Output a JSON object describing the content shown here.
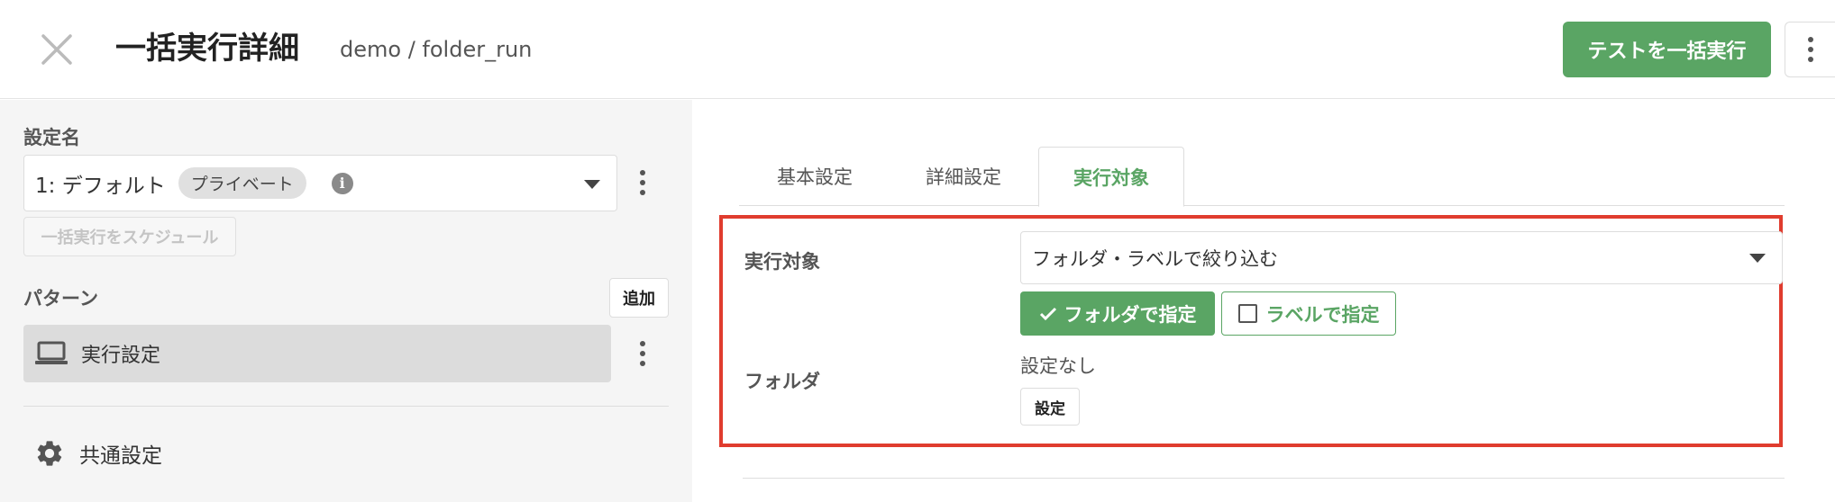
{
  "header": {
    "title": "一括実行詳細",
    "breadcrumb": "demo / folder_run",
    "run_button": "テストを一括実行",
    "close_icon": "close-icon",
    "more_icon": "more-vertical-icon"
  },
  "sidebar": {
    "config_label": "設定名",
    "config_value": "1: デフォルト",
    "private_badge": "プライベート",
    "info_icon_text": "i",
    "schedule_button": "一括実行をスケジュール",
    "pattern_label": "パターン",
    "add_button": "追加",
    "pattern_items": [
      {
        "label": "実行設定",
        "icon": "laptop-icon"
      }
    ],
    "common_settings": "共通設定",
    "common_settings_icon": "gear-icon"
  },
  "main": {
    "tabs": [
      {
        "label": "基本設定",
        "active": false
      },
      {
        "label": "詳細設定",
        "active": false
      },
      {
        "label": "実行対象",
        "active": true
      }
    ],
    "target": {
      "label": "実行対象",
      "select_value": "フォルダ・ラベルで絞り込む",
      "folder_toggle": "フォルダで指定",
      "folder_toggle_checked": true,
      "label_toggle": "ラベルで指定",
      "label_toggle_checked": false
    },
    "folder": {
      "label": "フォルダ",
      "value": "設定なし",
      "set_button": "設定"
    }
  },
  "colors": {
    "accent_green": "#5aa564",
    "highlight_red": "#e03c2e",
    "sidebar_bg": "#f5f5f5"
  }
}
